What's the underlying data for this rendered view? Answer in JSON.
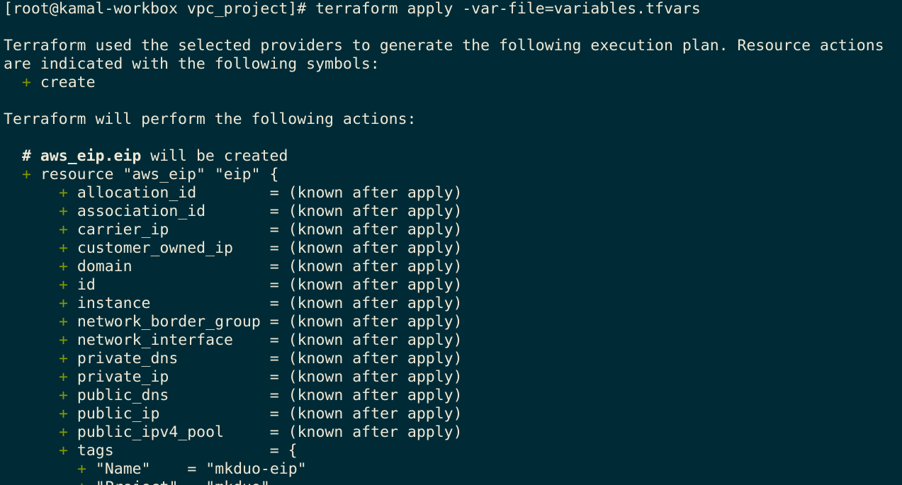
{
  "terminal": {
    "prompt": "[root@kamal-workbox vpc_project]# ",
    "command": "terraform apply -var-file=variables.tfvars",
    "intro_line1": "Terraform used the selected providers to generate the following execution plan. Resource actions",
    "intro_line2": "are indicated with the following symbols:",
    "symbol_plus": "+",
    "symbol_create": " create",
    "actions_line": "Terraform will perform the following actions:",
    "comment_hash": "# ",
    "resource_name": "aws_eip.eip",
    "will_be_created": " will be created",
    "resource_decl": " resource \"aws_eip\" \"eip\" {",
    "attributes": [
      {
        "name": "allocation_id        ",
        "value": "= (known after apply)"
      },
      {
        "name": "association_id       ",
        "value": "= (known after apply)"
      },
      {
        "name": "carrier_ip           ",
        "value": "= (known after apply)"
      },
      {
        "name": "customer_owned_ip    ",
        "value": "= (known after apply)"
      },
      {
        "name": "domain               ",
        "value": "= (known after apply)"
      },
      {
        "name": "id                   ",
        "value": "= (known after apply)"
      },
      {
        "name": "instance             ",
        "value": "= (known after apply)"
      },
      {
        "name": "network_border_group ",
        "value": "= (known after apply)"
      },
      {
        "name": "network_interface    ",
        "value": "= (known after apply)"
      },
      {
        "name": "private_dns          ",
        "value": "= (known after apply)"
      },
      {
        "name": "private_ip           ",
        "value": "= (known after apply)"
      },
      {
        "name": "public_dns           ",
        "value": "= (known after apply)"
      },
      {
        "name": "public_ip            ",
        "value": "= (known after apply)"
      },
      {
        "name": "public_ipv4_pool     ",
        "value": "= (known after apply)"
      },
      {
        "name": "tags                 ",
        "value": "= {"
      }
    ],
    "tags": [
      {
        "key": "\"Name\"    ",
        "value": "= \"mkduo-eip\""
      },
      {
        "key": "\"Project\" ",
        "value": "= \"mkduo\""
      }
    ]
  }
}
